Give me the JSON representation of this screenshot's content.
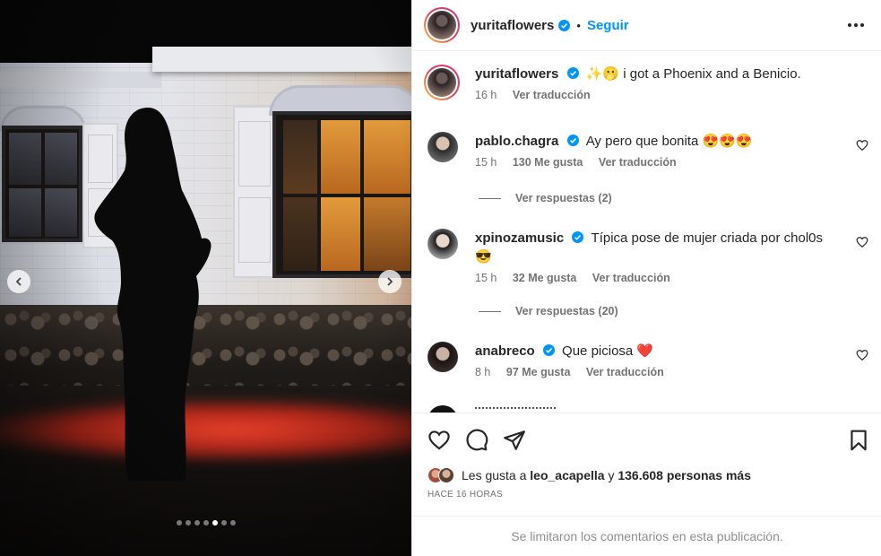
{
  "post": {
    "author": "yuritaflowers",
    "follow_label": "Seguir",
    "separator": "•",
    "caption": {
      "username": "yuritaflowers",
      "emoji": "✨🫢",
      "text": "i got a Phoenix and a Benicio.",
      "time": "16 h",
      "translate": "Ver traducción"
    },
    "carousel": {
      "slide_count": 7,
      "active_slide": 5
    }
  },
  "comments": [
    {
      "username": "pablo.chagra",
      "text": "Ay pero que bonita 😍😍😍",
      "time": "15 h",
      "likes": "130 Me gusta",
      "translate": "Ver traducción",
      "replies": "Ver respuestas (2)"
    },
    {
      "username": "xpinozamusic",
      "text": "Típica pose de mujer criada por chol0s",
      "text2": "😎",
      "time": "15 h",
      "likes": "32 Me gusta",
      "translate": "Ver traducción",
      "replies": "Ver respuestas (20)"
    },
    {
      "username": "anabreco",
      "text": "Que piciosa ❤️",
      "time": "8 h",
      "likes": "97 Me gusta",
      "translate": "Ver traducción"
    }
  ],
  "likes": {
    "prefix": "Les gusta a",
    "user": "leo_acapella",
    "conj": "y",
    "others": "136.608 personas más"
  },
  "posted_ago": "HACE 16 HORAS",
  "comments_limited": "Se limitaron los comentarios en esta publicación.",
  "colors": {
    "accent": "#0095f6",
    "verified": "#0095f6",
    "muted": "#737373"
  },
  "icons": [
    "chevron-left-icon",
    "chevron-right-icon",
    "more-icon",
    "verified-icon",
    "heart-icon",
    "comment-icon",
    "share-icon",
    "bookmark-icon"
  ]
}
